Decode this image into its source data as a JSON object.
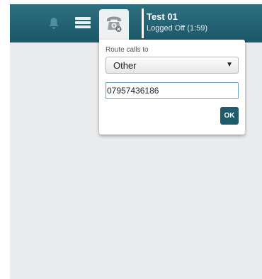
{
  "header": {
    "user_name": "Test 01",
    "user_status": "Logged Off (1:59)",
    "icons": [
      "bell-icon",
      "menu-icon",
      "phone-icon"
    ]
  },
  "route_popup": {
    "label": "Route calls to",
    "selected_option": "Other",
    "dropdown_arrow": "▼",
    "phone_number": "07957436186",
    "ok_label": "OK"
  },
  "colors": {
    "header_bg": "#1f5e6e",
    "ok_button_bg": "#1f5b6a",
    "background": "#e9ebec"
  }
}
